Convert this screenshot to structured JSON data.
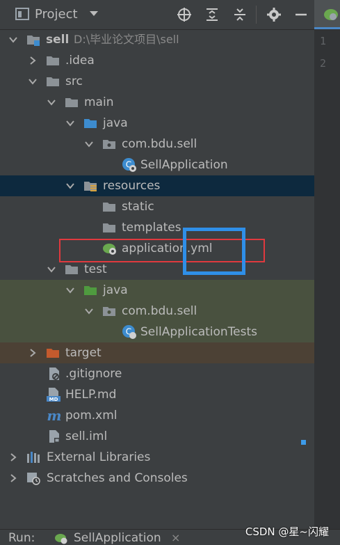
{
  "toolbar": {
    "title": "Project",
    "icons": [
      "target-icon",
      "expand-all-icon",
      "collapse-all-icon",
      "gear-icon",
      "minimize-icon"
    ]
  },
  "editor": {
    "line_numbers": [
      "1",
      "2"
    ]
  },
  "tree": {
    "root": {
      "label": "sell",
      "path": "D:\\毕业论文项目\\sell"
    },
    "idea": ".idea",
    "src": "src",
    "main": "main",
    "main_java": "java",
    "main_package": "com.bdu.sell",
    "main_class": "SellApplication",
    "resources": "resources",
    "static": "static",
    "templates": "templates",
    "app_yml": "application.yml",
    "test": "test",
    "test_java": "java",
    "test_package": "com.bdu.sell",
    "test_class": "SellApplicationTests",
    "target": "target",
    "gitignore": ".gitignore",
    "help": "HELP.md",
    "pom": "pom.xml",
    "iml": "sell.iml",
    "external_libraries": "External Libraries",
    "scratches": "Scratches and Consoles"
  },
  "run": {
    "label": "Run:",
    "config": "SellApplication",
    "close": "×"
  },
  "watermark": "CSDN @星~闪耀",
  "colors": {
    "folder": "#8c9297",
    "source_folder": "#3d8ccf",
    "test_folder": "#4f9b3f",
    "excluded_folder": "#c45a2d",
    "selection": "#0d293e",
    "highlight_red": "#e0393e",
    "highlight_blue": "#2f8fe8"
  }
}
